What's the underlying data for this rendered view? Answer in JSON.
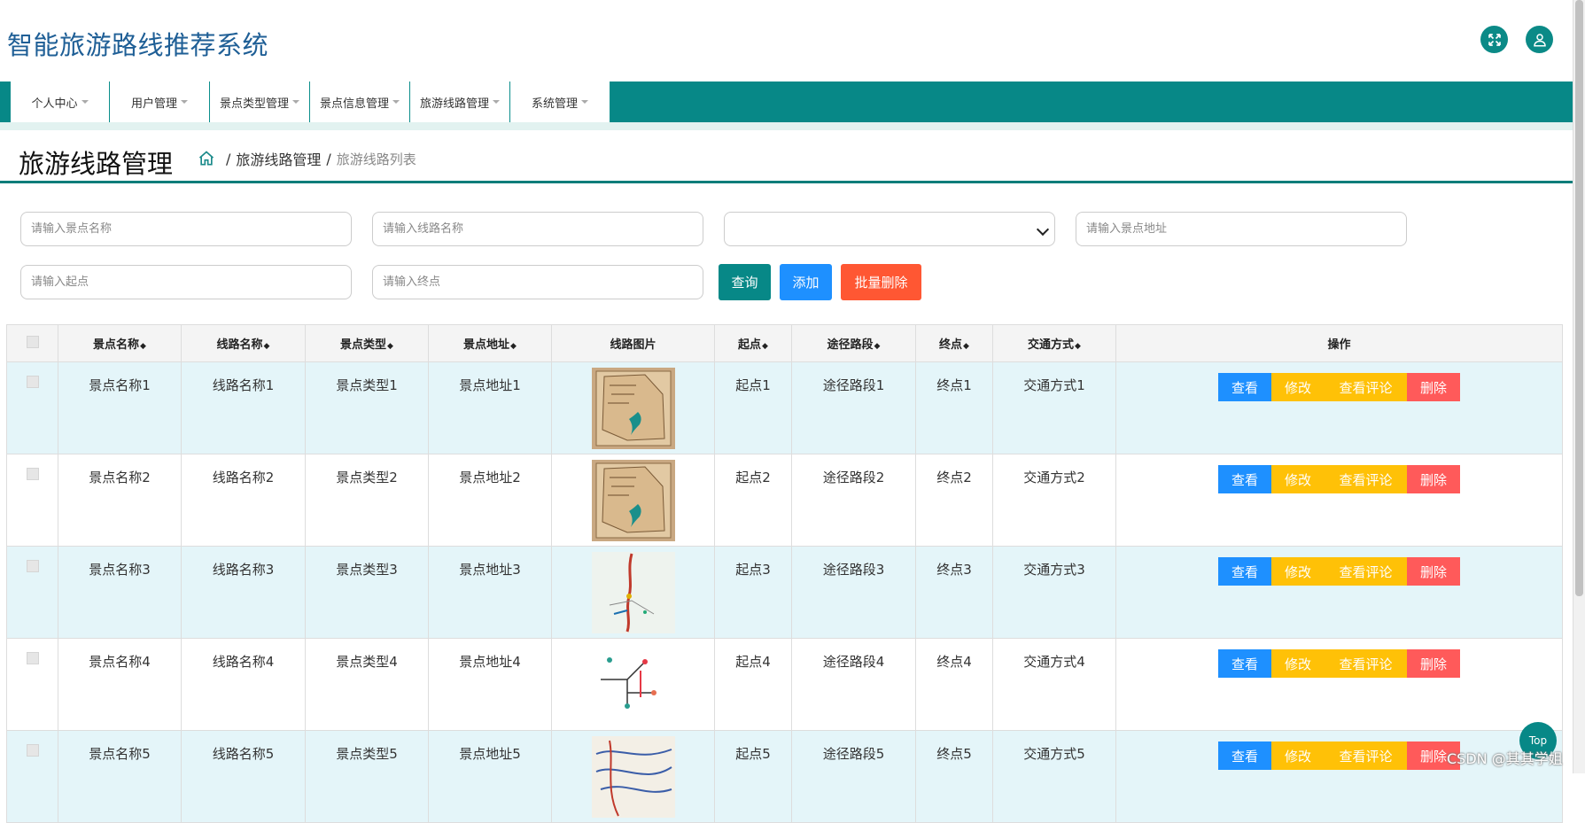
{
  "header": {
    "title": "智能旅游路线推荐系统",
    "fullscreen_icon": "fullscreen-icon",
    "user_icon": "user-icon"
  },
  "nav": {
    "items": [
      {
        "label": "个人中心",
        "width": 112
      },
      {
        "label": "用户管理",
        "width": 113
      },
      {
        "label": "景点类型管理",
        "width": 113
      },
      {
        "label": "景点信息管理",
        "width": 113
      },
      {
        "label": "旅游线路管理",
        "width": 113
      },
      {
        "label": "系统管理",
        "width": 113
      }
    ]
  },
  "page": {
    "title": "旅游线路管理"
  },
  "breadcrumb": {
    "home_icon": "home-icon",
    "section": "旅游线路管理",
    "current": "旅游线路列表",
    "separator": "/"
  },
  "filters": {
    "spot_name_placeholder": "请输入景点名称",
    "route_name_placeholder": "请输入线路名称",
    "spot_type_value": "",
    "spot_address_placeholder": "请输入景点地址",
    "start_placeholder": "请输入起点",
    "end_placeholder": "请输入终点"
  },
  "buttons": {
    "query": "查询",
    "add": "添加",
    "batch_delete": "批量删除"
  },
  "table": {
    "headers": {
      "spot_name": "景点名称",
      "route_name": "线路名称",
      "spot_type": "景点类型",
      "spot_address": "景点地址",
      "route_image": "线路图片",
      "start": "起点",
      "waypoints": "途径路段",
      "end": "终点",
      "transport": "交通方式",
      "actions": "操作"
    },
    "sort_icon": "◆",
    "rows": [
      {
        "spot_name": "景点名称1",
        "route_name": "线路名称1",
        "spot_type": "景点类型1",
        "spot_address": "景点地址1",
        "start": "起点1",
        "waypoints": "途径路段1",
        "end": "终点1",
        "transport": "交通方式1",
        "image": "vintage-map"
      },
      {
        "spot_name": "景点名称2",
        "route_name": "线路名称2",
        "spot_type": "景点类型2",
        "spot_address": "景点地址2",
        "start": "起点2",
        "waypoints": "途径路段2",
        "end": "终点2",
        "transport": "交通方式2",
        "image": "vintage-map"
      },
      {
        "spot_name": "景点名称3",
        "route_name": "线路名称3",
        "spot_type": "景点类型3",
        "spot_address": "景点地址3",
        "start": "起点3",
        "waypoints": "途径路段3",
        "end": "终点3",
        "transport": "交通方式3",
        "image": "route-line-map"
      },
      {
        "spot_name": "景点名称4",
        "route_name": "线路名称4",
        "spot_type": "景点类型4",
        "spot_address": "景点地址4",
        "start": "起点4",
        "waypoints": "途径路段4",
        "end": "终点4",
        "transport": "交通方式4",
        "image": "schematic-map"
      },
      {
        "spot_name": "景点名称5",
        "route_name": "线路名称5",
        "spot_type": "景点类型5",
        "spot_address": "景点地址5",
        "start": "起点5",
        "waypoints": "途径路段5",
        "end": "终点5",
        "transport": "交通方式5",
        "image": "road-map"
      }
    ],
    "row_actions": {
      "view": "查看",
      "edit": "修改",
      "comments": "查看评论",
      "delete": "删除"
    }
  },
  "top_button": "Top",
  "watermark": "CSDN @其其学姐",
  "colors": {
    "teal": "#078887",
    "title_blue": "#1f5f96",
    "blue": "#1e90ff",
    "yellow": "#ffc107",
    "red": "#ff5a5a",
    "orange_red": "#ff5733",
    "row_alt": "#e4f5f9"
  }
}
